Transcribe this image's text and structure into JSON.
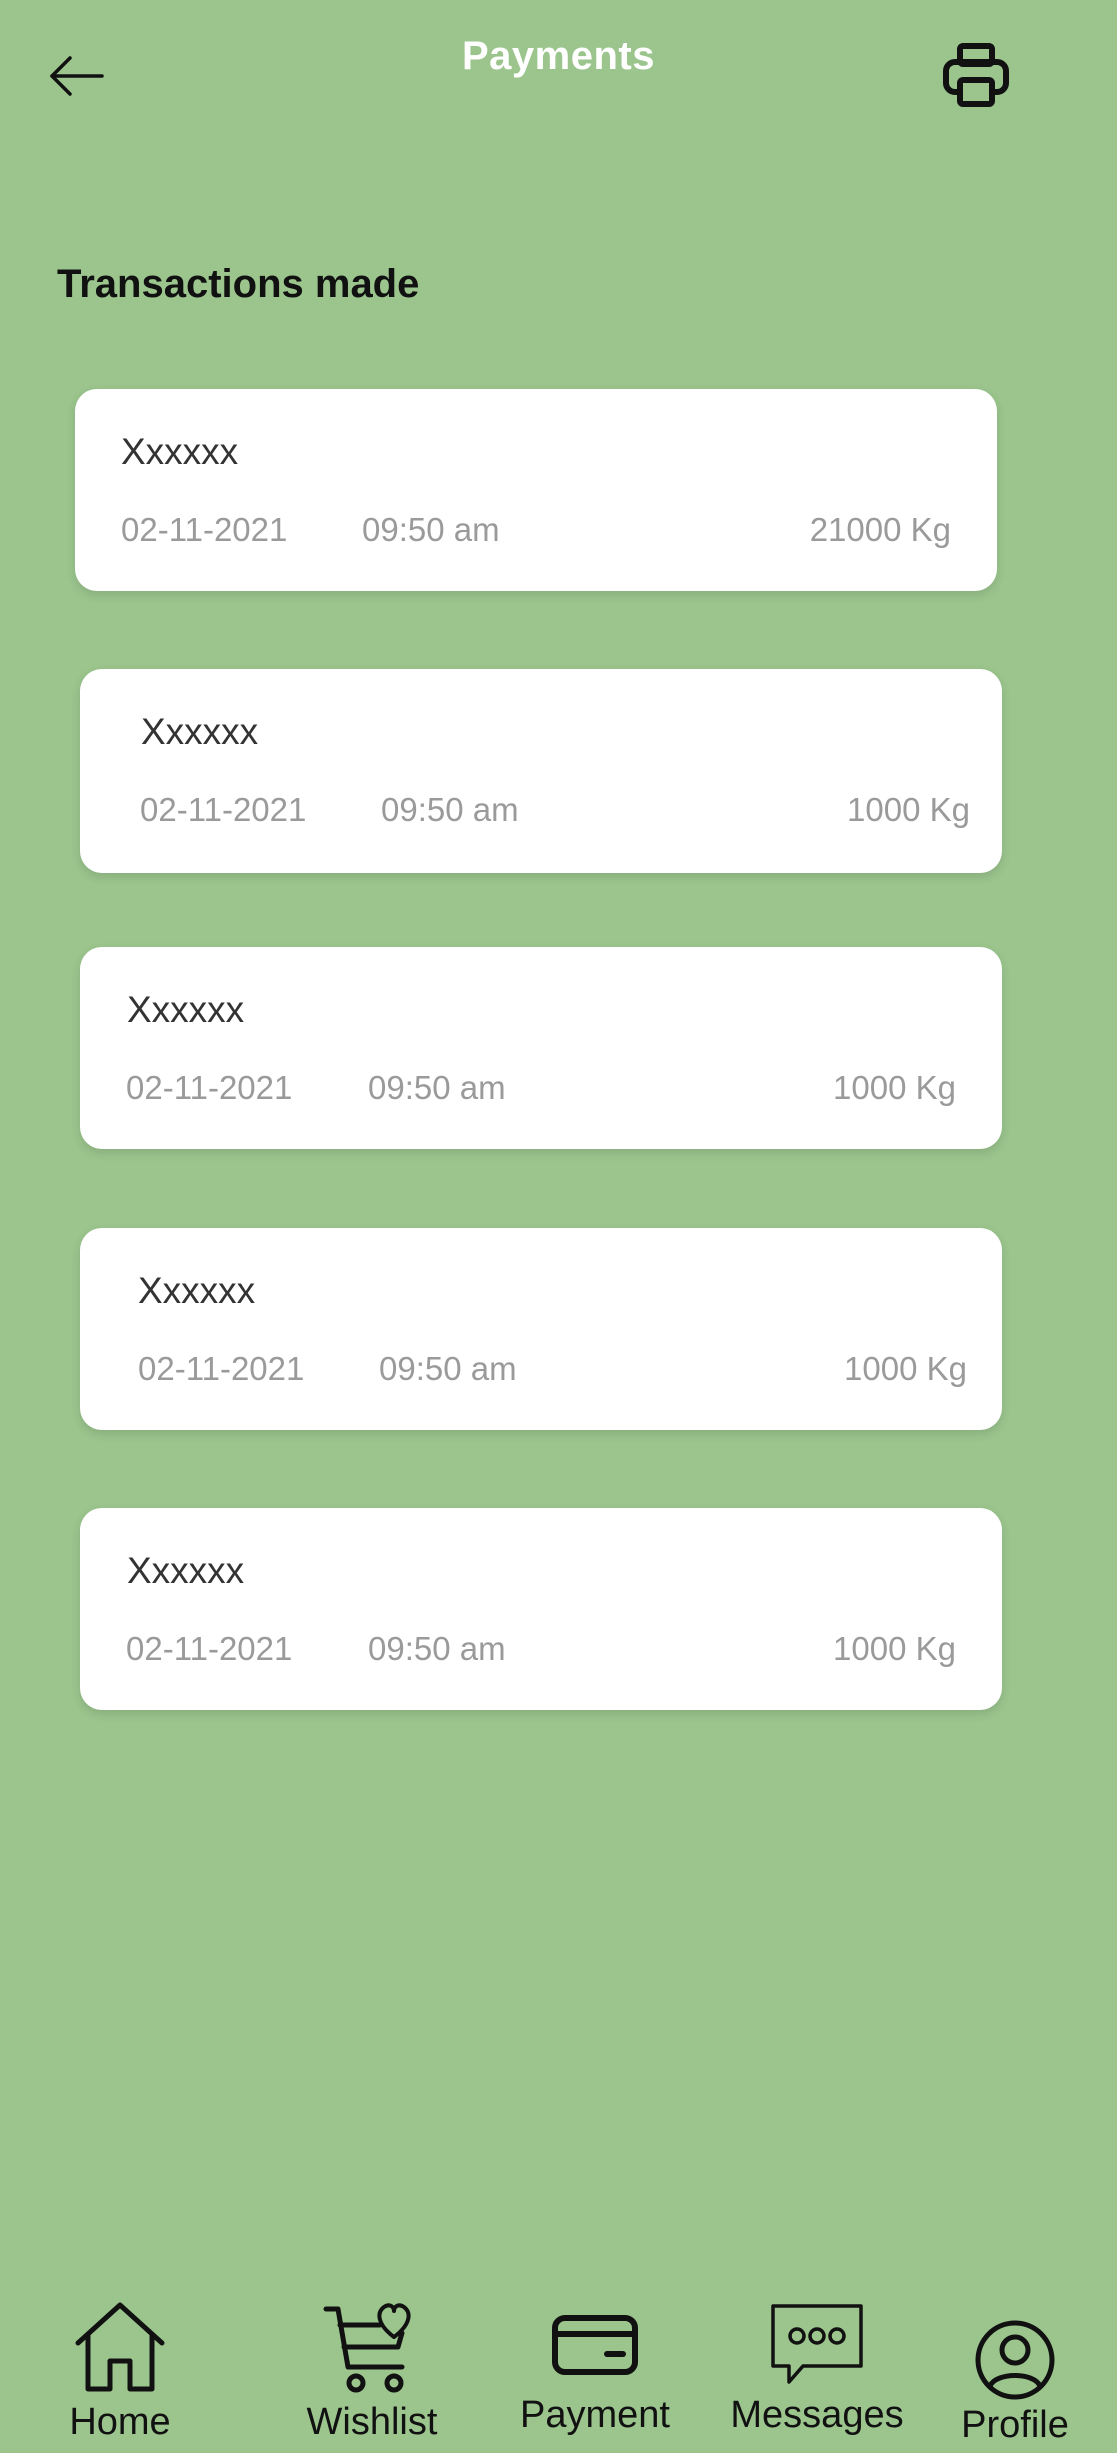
{
  "header": {
    "title": "Payments",
    "back_icon": "arrow-left-icon",
    "print_icon": "printer-icon"
  },
  "section_title": "Transactions made",
  "transactions": [
    {
      "name": "Xxxxxx",
      "date": "02-11-2021",
      "time": "09:50  am",
      "amount": "21000 Kg"
    },
    {
      "name": "Xxxxxx",
      "date": "02-11-2021",
      "time": "09:50  am",
      "amount": "1000 Kg"
    },
    {
      "name": "Xxxxxx",
      "date": "02-11-2021",
      "time": "09:50  am",
      "amount": "1000 Kg"
    },
    {
      "name": "Xxxxxx",
      "date": "02-11-2021",
      "time": "09:50  am",
      "amount": "1000 Kg"
    },
    {
      "name": "Xxxxxx",
      "date": "02-11-2021",
      "time": "09:50  am",
      "amount": "1000 Kg"
    }
  ],
  "nav": {
    "items": [
      {
        "label": "Home",
        "icon": "home-icon"
      },
      {
        "label": "Wishlist",
        "icon": "cart-heart-icon"
      },
      {
        "label": "Payment",
        "icon": "card-icon"
      },
      {
        "label": "Messages",
        "icon": "chat-icon"
      },
      {
        "label": "Profile",
        "icon": "user-icon"
      }
    ]
  },
  "colors": {
    "background": "#9bc58d",
    "card": "#ffffff",
    "title": "#ffffff"
  }
}
